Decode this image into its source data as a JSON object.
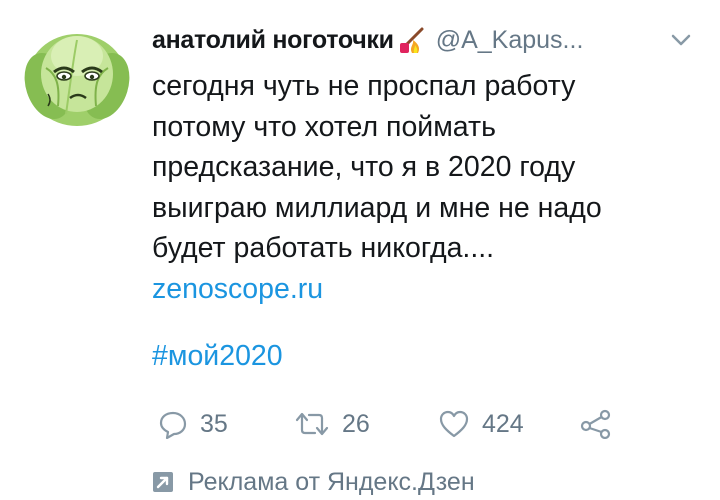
{
  "tweet": {
    "display_name": "анатолий ноготочки",
    "name_emoji": "nail-polish-fire-emoji",
    "handle": "@A_Kapus...",
    "text": "сегодня чуть не проспал работу потому что хотел поймать предсказание, что я в 2020 году выиграю миллиард и мне не надо будет работать никогда....",
    "link": "zenoscope.ru",
    "hashtag": "#мой2020",
    "actions": {
      "reply_count": "35",
      "retweet_count": "26",
      "like_count": "424"
    },
    "promoted_label": "Реклама от Яндекс.Дзен"
  },
  "icons": {
    "caret": "chevron-down-icon",
    "reply": "reply-icon",
    "retweet": "retweet-icon",
    "like": "heart-icon",
    "share": "share-icon",
    "promoted": "promoted-arrow-icon"
  },
  "colors": {
    "text": "#14171a",
    "secondary": "#657786",
    "link": "#1b95e0",
    "icon": "#8899a6"
  }
}
